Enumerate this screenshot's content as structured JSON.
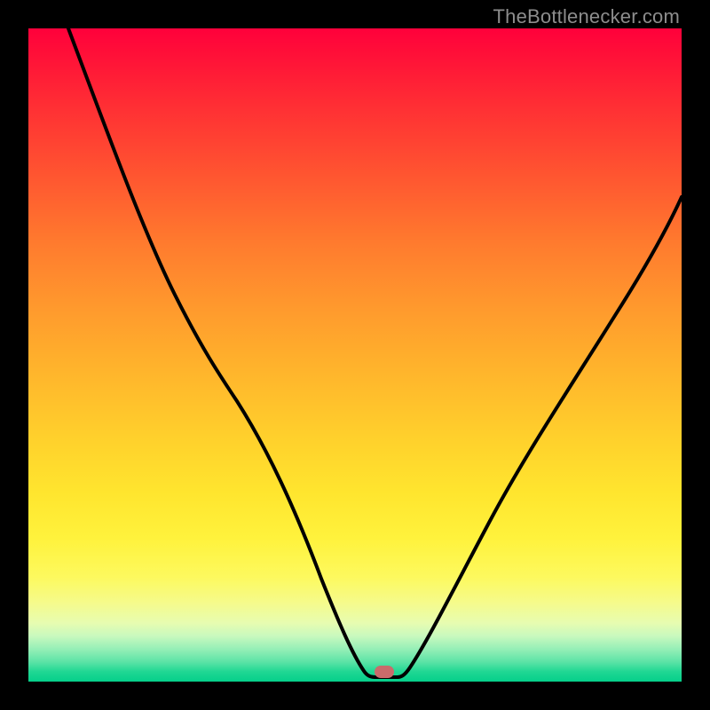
{
  "watermark": {
    "text": "TheBottlenecker.com"
  },
  "marker": {
    "color": "#c96b6b",
    "x_frac": 0.545,
    "y_frac": 0.985
  },
  "chart_data": {
    "type": "line",
    "title": "",
    "xlabel": "",
    "ylabel": "",
    "xlim": [
      0,
      1
    ],
    "ylim": [
      0,
      1
    ],
    "x": [
      0.0,
      0.05,
      0.1,
      0.15,
      0.2,
      0.25,
      0.3,
      0.35,
      0.4,
      0.45,
      0.5,
      0.525,
      0.55,
      0.575,
      0.6,
      0.65,
      0.7,
      0.75,
      0.8,
      0.85,
      0.9,
      0.95,
      1.0
    ],
    "values": [
      1.0,
      0.88,
      0.78,
      0.7,
      0.64,
      0.59,
      0.55,
      0.47,
      0.38,
      0.24,
      0.06,
      0.02,
      0.02,
      0.04,
      0.09,
      0.2,
      0.32,
      0.43,
      0.53,
      0.62,
      0.69,
      0.75,
      0.79
    ],
    "curve_min_x": 0.545,
    "marker": {
      "x": 0.545,
      "y": 0.015
    },
    "background_gradient": {
      "top": "#ff003b",
      "mid": "#ffe52e",
      "bottom": "#05cf8a"
    }
  }
}
